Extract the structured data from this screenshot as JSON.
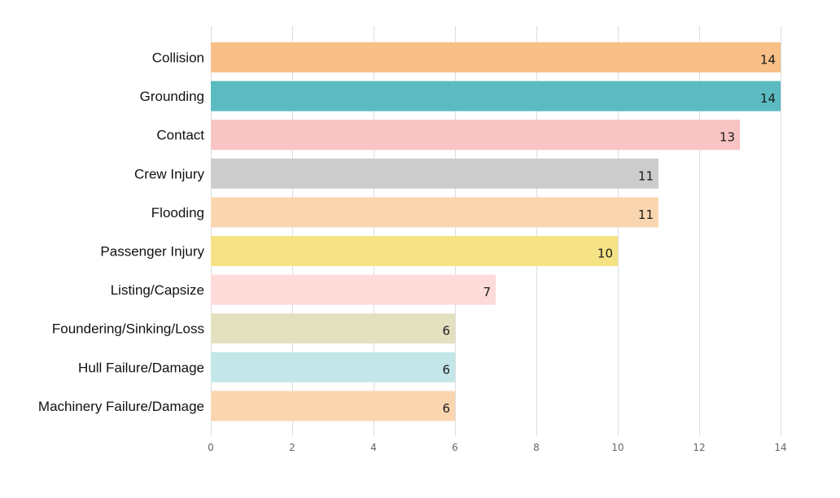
{
  "chart_data": {
    "type": "bar",
    "orientation": "horizontal",
    "title": "",
    "xlabel": "",
    "ylabel": "",
    "xlim": [
      0,
      14
    ],
    "xticks": [
      0,
      2,
      4,
      6,
      8,
      10,
      12,
      14
    ],
    "grid": true,
    "legend": "none",
    "categories": [
      "Collision",
      "Grounding",
      "Contact",
      "Crew Injury",
      "Flooding",
      "Passenger Injury",
      "Listing/Capsize",
      "Foundering/Sinking/Loss",
      "Hull Failure/Damage",
      "Machinery Failure/Damage"
    ],
    "values": [
      14,
      14,
      13,
      11,
      11,
      10,
      7,
      6,
      6,
      6
    ],
    "colors": [
      "#f8c086",
      "#5bbbc1",
      "#f9c4c4",
      "#cccccc",
      "#fad6b0",
      "#f4e285",
      "#fddbd8",
      "#e3e0c0",
      "#c3e6e8",
      "#fad6b0"
    ]
  }
}
